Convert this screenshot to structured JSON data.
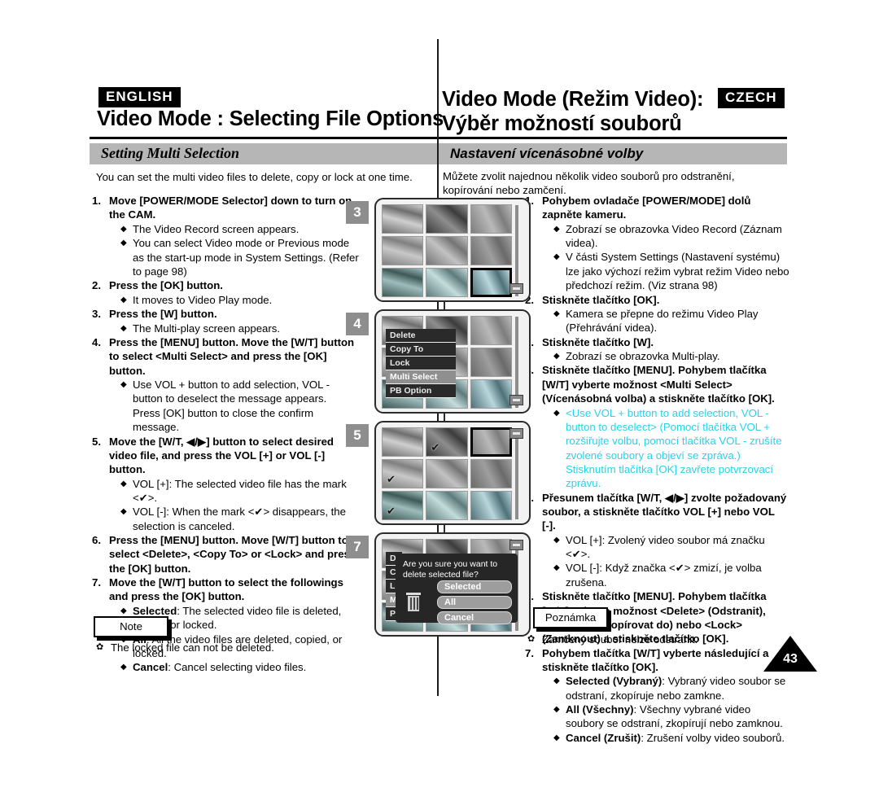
{
  "page": {
    "number": "43"
  },
  "left": {
    "lang_badge": "ENGLISH",
    "title": "Video Mode : Selecting File Options",
    "section": "Setting Multi Selection",
    "intro": "You can set the multi video files to delete, copy or lock at one time.",
    "note_label": "Note",
    "note_bullet": "✿",
    "note_text": "The locked file can not be deleted.",
    "steps": [
      {
        "num": "1.",
        "head": "Move [POWER/MODE Selector] down to turn on the CAM.",
        "bullets": [
          "The Video Record screen appears.",
          "You can select Video mode or Previous mode as the start-up mode in System Settings. (Refer to page 98)"
        ]
      },
      {
        "num": "2.",
        "head": "Press the [OK] button.",
        "bullets": [
          "It moves to Video Play mode."
        ]
      },
      {
        "num": "3.",
        "head": "Press the [W] button.",
        "bullets": [
          "The Multi-play screen appears."
        ]
      },
      {
        "num": "4.",
        "head": "Press the [MENU] button. Move the [W/T] button to select <Multi Select> and press the [OK] button.",
        "bullets": [
          "Use VOL + button to add selection, VOL - button to deselect the message appears."
        ],
        "sub": "Press [OK] button to close the confirm message."
      },
      {
        "num": "5.",
        "head": "Move the [W/T, ◀/▶] button to select desired video file, and press the VOL [+] or VOL [-] button.",
        "bullets": [
          "VOL [+]: The selected video file has the mark <✔>.",
          "VOL [-]: When the mark <✔> disappears, the selection is canceled."
        ]
      },
      {
        "num": "6.",
        "head": "Press the [MENU] button. Move [W/T] button to select <Delete>, <Copy To> or <Lock> and press the [OK] button.",
        "bullets": []
      },
      {
        "num": "7.",
        "head": "Move the [W/T] button to select the followings and press the [OK] button.",
        "bullets": [],
        "def_bullets": [
          {
            "term": "Selected",
            "desc": ": The selected video file is deleted, copied, or locked."
          },
          {
            "term": "All",
            "desc": ": All the video files are deleted, copied, or locked."
          },
          {
            "term": "Cancel",
            "desc": ": Cancel selecting video files."
          }
        ]
      }
    ]
  },
  "right": {
    "lang_badge": "CZECH",
    "title_line1": "Video Mode (Režim Video):",
    "title_line2": "Výběr možností souborů",
    "section": "Nastavení vícenásobné volby",
    "intro": "Můžete zvolit najednou několik video souborů pro odstranění, kopírování nebo zamčení.",
    "note_label": "Poznámka",
    "note_bullet": "✿",
    "note_text": "Zamčený soubor nelze odstranit.",
    "steps": [
      {
        "num": "1.",
        "head": "Pohybem ovladače [POWER/MODE] dolů zapněte kameru.",
        "bullets": [
          "Zobrazí se obrazovka Video Record (Záznam videa).",
          "V části System Settings (Nastavení systému) lze jako výchozí režim vybrat režim Video nebo předchozí režim. (Viz strana 98)"
        ]
      },
      {
        "num": "2.",
        "head": "Stiskněte tlačítko [OK].",
        "bullets": [
          "Kamera se přepne do režimu Video Play (Přehrávání videa)."
        ]
      },
      {
        "num": "3.",
        "head": "Stiskněte tlačítko [W].",
        "bullets": [
          "Zobrazí se obrazovka Multi-play."
        ]
      },
      {
        "num": "4.",
        "head": "Stiskněte tlačítko [MENU]. Pohybem tlačítka [W/T] vyberte možnost <Multi Select> (Vícenásobná volba) a stiskněte tlačítko [OK].",
        "bullets_cyan": [
          "<Use VOL + button to add selection, VOL - button to deselect> (Pomocí tlačítka VOL + rozšiřujte volbu, pomocí tlačítka VOL - zrušíte zvolené soubory a objeví se zpráva.) Stisknutím tlačítka [OK] zavřete potvrzovací zprávu."
        ]
      },
      {
        "num": "5.",
        "head": "Přesunem tlačítka [W/T, ◀/▶] zvolte požadovaný soubor, a stiskněte tlačítko VOL [+] nebo VOL [-].",
        "bullets": [
          "VOL [+]: Zvolený video soubor má značku <✔>.",
          "VOL [-]: Když značka <✔> zmizí, je volba zrušena."
        ]
      },
      {
        "num": "6.",
        "head": "Stiskněte tlačítko [MENU]. Pohybem tlačítka [W/T] vyberte možnost <Delete> (Odstranit), <Copy To> (Kopírovat do) nebo <Lock> (Zamknout) a stiskněte tlačítko [OK].",
        "bullets": []
      },
      {
        "num": "7.",
        "head": "Pohybem tlačítka [W/T] vyberte následující a stiskněte tlačítko [OK].",
        "bullets": [],
        "def_bullets": [
          {
            "term": "Selected (Vybraný)",
            "desc": ": Vybraný video soubor se odstraní, zkopíruje nebo zamkne."
          },
          {
            "term": "All (Všechny)",
            "desc": ": Všechny vybrané video soubory se odstraní, zkopírují nebo zamknou."
          },
          {
            "term": "Cancel (Zrušit)",
            "desc": ": Zrušení volby video souborů."
          }
        ]
      }
    ]
  },
  "illustration": {
    "panels": [
      {
        "badge": "3",
        "kind": "grid"
      },
      {
        "badge": "4",
        "kind": "menu"
      },
      {
        "badge": "5",
        "kind": "marked"
      },
      {
        "badge": "7",
        "kind": "dialog"
      }
    ],
    "menu_items": [
      "Delete",
      "Copy To",
      "Lock",
      "Multi Select",
      "PB Option"
    ],
    "menu_highlight": "Multi Select",
    "dialog": {
      "message": "Are you sure you want to delete selected file?",
      "buttons": [
        "Selected",
        "All",
        "Cancel"
      ],
      "icon": "trash-icon"
    },
    "thumbnails": [
      {
        "name": "boy-on-beach",
        "c1": "#cfcfcf",
        "c2": "#6e6e6e"
      },
      {
        "name": "palm-tree",
        "c1": "#8e8e8e",
        "c2": "#3c3c3c"
      },
      {
        "name": "rabbit",
        "c1": "#b9b9b9",
        "c2": "#7d7d7d"
      },
      {
        "name": "coastline",
        "c1": "#c8c8c8",
        "c2": "#808080"
      },
      {
        "name": "child-garden",
        "c1": "#c2c2c2",
        "c2": "#747474"
      },
      {
        "name": "city-skyline",
        "c1": "#9e9e9e",
        "c2": "#6a6a6a"
      },
      {
        "name": "water-lily",
        "c1": "#9dbcbb",
        "c2": "#3e5a58"
      },
      {
        "name": "dog",
        "c1": "#c3dcdc",
        "c2": "#5e7b7c"
      },
      {
        "name": "dolphin",
        "c1": "#b9d6db",
        "c2": "#4e7279"
      }
    ],
    "marks_panel5": [
      1,
      3,
      6
    ],
    "selected_panel3": 8,
    "selected_panel5": 2
  }
}
